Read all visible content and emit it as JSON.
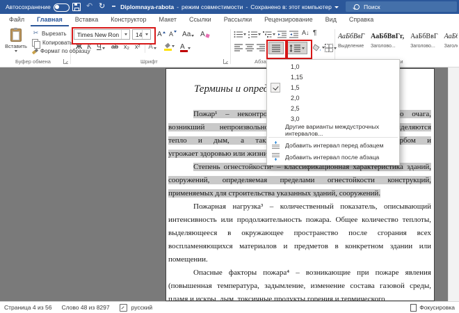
{
  "titlebar": {
    "autosave": "Автосохранение",
    "doc_title": "Diplomnaya-rabota",
    "sep": "-",
    "mode": "режим совместимости",
    "saved": "Сохранено в: этот компьютер",
    "search_placeholder": "Поиск"
  },
  "tabs": {
    "items": [
      "Файл",
      "Главная",
      "Вставка",
      "Конструктор",
      "Макет",
      "Ссылки",
      "Рассылки",
      "Рецензирование",
      "Вид",
      "Справка"
    ],
    "active": "Главная"
  },
  "ribbon": {
    "clipboard": {
      "group": "Буфер обмена",
      "paste": "Вставить",
      "cut": "Вырезать",
      "copy": "Копировать",
      "format_painter": "Формат по образцу"
    },
    "font": {
      "group": "Шрифт",
      "name_value": "Times New Ron",
      "size_value": "14",
      "grow": "А",
      "shrink": "А",
      "change_case": "Аа",
      "clear": "А",
      "bold": "Ж",
      "italic": "К",
      "underline": "Ч",
      "strike": "ab",
      "subscript": "x₂",
      "superscript": "x²",
      "effects": "А",
      "color": "А"
    },
    "paragraph": {
      "group": "Абзац",
      "sort": "А↓",
      "pilcrow": "¶"
    },
    "styles": {
      "group": "Стили",
      "items": [
        {
          "sample": "АаБбВвГ",
          "name": "Выделение",
          "variant": "italic"
        },
        {
          "sample": "АаБбВвГг,",
          "name": "Заголово...",
          "variant": "bold"
        },
        {
          "sample": "АаБбВвГ",
          "name": "Заголово...",
          "variant": "normal"
        },
        {
          "sample": "АаБбВвГ",
          "name": "Заголово...",
          "variant": "italic"
        },
        {
          "sample": "А",
          "name": "З",
          "variant": "normal"
        }
      ]
    },
    "accent_color": "#2b579a",
    "annotation_color": "#d71616"
  },
  "spacing_menu": {
    "options": [
      "1,0",
      "1,15",
      "1,5",
      "2,0",
      "2,5",
      "3,0"
    ],
    "checked": "1,5",
    "more": "Другие варианты междустрочных интервалов...",
    "add_before": "Добавить интервал перед абзацем",
    "add_after": "Добавить интервал после абзаца"
  },
  "document": {
    "heading": "Термины и определения",
    "selection_color": "#c9c9c9",
    "paragraphs": [
      {
        "highlight": true,
        "lines": [
          "Пожар¹ – неконтролируемое горение вне специального очага,",
          "возникший непроизвольно, в процессе которого выделяются",
          "тепло и дым, а также которое сопровождается ущербом и",
          "угрожает здоровью или жизни людей."
        ]
      },
      {
        "highlight": true,
        "lines": [
          "Степень огнестойкости² – классификационная характеристика зданий,",
          "сооружений, определяемая пределами огнестойкости конструкций,",
          "применяемых для строительства указанных зданий, сооружений."
        ]
      },
      {
        "highlight": false,
        "lines": [
          "Пожарная нагрузка³ – количественный показатель, описывающий",
          "интенсивность или продолжительность пожара. Общее количество теплоты,",
          "выделяющееся в окружающее пространство после сгорания всех",
          "воспламеняющихся материалов и предметов в конкретном здании или",
          "помещении."
        ]
      },
      {
        "highlight": false,
        "lines": [
          "Опасные факторы пожара⁴ – возникающие при пожаре явления",
          "(повышенная температура, задымление, изменение состава газовой среды,",
          "пламя и искры, дым, токсичные продукты горения и термического"
        ]
      }
    ]
  },
  "statusbar": {
    "page": "Страница 4 из 56",
    "words": "Слово 48 из 8297",
    "language": "русский",
    "focus": "Фокусировка"
  }
}
